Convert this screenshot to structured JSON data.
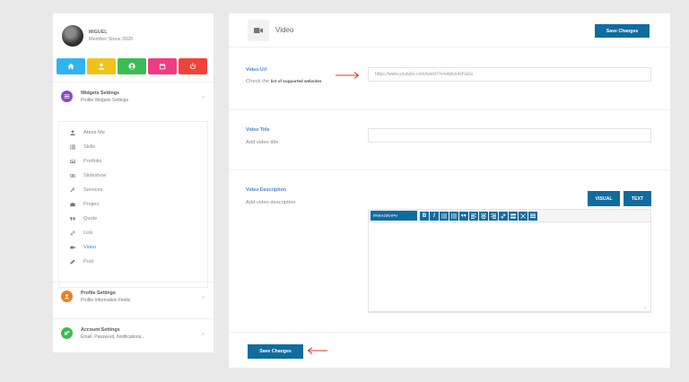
{
  "profile": {
    "name": "MIGUEL",
    "since": "Member Since 2020"
  },
  "quick_actions": [
    {
      "name": "home",
      "color": "#2fb4f0",
      "icon": "home-icon"
    },
    {
      "name": "user",
      "color": "#f0c21a",
      "icon": "user-icon"
    },
    {
      "name": "account",
      "color": "#3dbb55",
      "icon": "user-circle-icon"
    },
    {
      "name": "calendar",
      "color": "#f03c82",
      "icon": "calendar-icon"
    },
    {
      "name": "logout",
      "color": "#f04338",
      "icon": "power-icon"
    }
  ],
  "sections": {
    "widgets": {
      "title": "Widgets Settings",
      "subtitle": "Profile Widgets Settings",
      "color": "#8a47c9",
      "icon": "list-icon"
    },
    "profile": {
      "title": "Profile Settings",
      "subtitle": "Profile Information Fields",
      "color": "#ef7d1f",
      "icon": "user-circle-icon"
    },
    "account": {
      "title": "Account Settings",
      "subtitle": "Email, Password, Notifications...",
      "color": "#3dbb55",
      "icon": "gears-icon"
    }
  },
  "widget_items": [
    {
      "label": "About Me",
      "icon": "user-icon"
    },
    {
      "label": "Skills",
      "icon": "list-icon"
    },
    {
      "label": "Portfolio",
      "icon": "portfolio-icon"
    },
    {
      "label": "Slideshow",
      "icon": "slideshow-icon"
    },
    {
      "label": "Services",
      "icon": "wrench-icon"
    },
    {
      "label": "Project",
      "icon": "briefcase-icon"
    },
    {
      "label": "Quote",
      "icon": "quote-icon"
    },
    {
      "label": "Link",
      "icon": "link-icon"
    },
    {
      "label": "Video",
      "icon": "video-icon",
      "active": true
    },
    {
      "label": "Post",
      "icon": "pencil-icon"
    }
  ],
  "main": {
    "title": "Video",
    "save_label": "Save Changes",
    "url": {
      "label": "Video Url",
      "help_prefix": "Check the",
      "help_link": "list of supported websites",
      "value": "https://www.youtube.com/watch?v=okdvo4zFaGs"
    },
    "title_field": {
      "label": "Video Title",
      "help": "Add video title",
      "value": ""
    },
    "description": {
      "label": "Video Description",
      "help": "Add video description",
      "visual_label": "VISUAL",
      "text_label": "TEXT",
      "paragraph_label": "PARAGRAPH"
    },
    "accent_color": "#0f6c9f",
    "arrow_color": "#d9332b"
  }
}
